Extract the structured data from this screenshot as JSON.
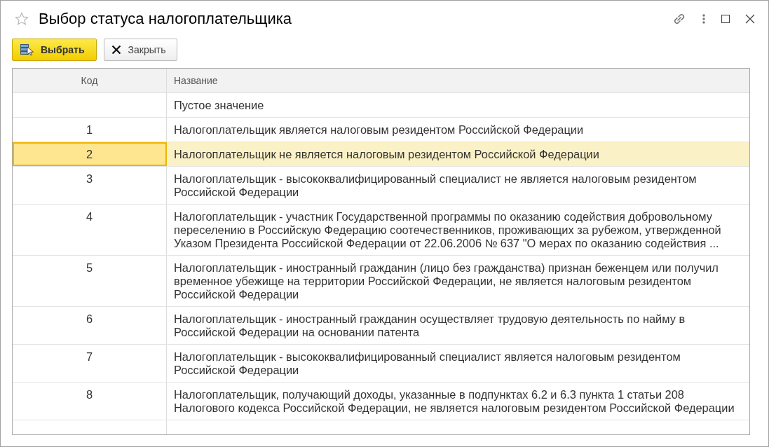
{
  "window": {
    "title": "Выбор статуса налогоплательщика"
  },
  "toolbar": {
    "buttons": [
      {
        "label": "Выбрать",
        "kind": "primary"
      },
      {
        "label": "Закрыть",
        "kind": "close"
      }
    ]
  },
  "table": {
    "columns": [
      "Код",
      "Название"
    ],
    "rows": [
      {
        "code": "",
        "name": "Пустое значение",
        "selected": false
      },
      {
        "code": "1",
        "name": "Налогоплательщик является налоговым резидентом Российской Федерации",
        "selected": false
      },
      {
        "code": "2",
        "name": "Налогоплательщик не является налоговым резидентом Российской Федерации",
        "selected": true
      },
      {
        "code": "3",
        "name": "Налогоплательщик - высококвалифицированный специалист не является налоговым резидентом Российской Федерации",
        "selected": false
      },
      {
        "code": "4",
        "name": "Налогоплательщик - участник Государственной программы по оказанию содействия добровольному переселению в Российскую Федерацию соотечественников, проживающих за рубежом, утвержденной Указом Президента Российской Федерации от 22.06.2006 № 637 \"О мерах по оказанию содействия ...",
        "selected": false
      },
      {
        "code": "5",
        "name": "Налогоплательщик - иностранный гражданин (лицо без гражданства) признан беженцем или получил временное убежище на территории Российской Федерации, не является налоговым резидентом Российской Федерации",
        "selected": false
      },
      {
        "code": "6",
        "name": "Налогоплательщик - иностранный гражданин осуществляет трудовую деятельность по найму в Российской Федерации на основании патента",
        "selected": false
      },
      {
        "code": "7",
        "name": "Налогоплательщик - высококвалифицированный специалист является налоговым резидентом Российской Федерации",
        "selected": false
      },
      {
        "code": "8",
        "name": "Налогоплательщик, получающий доходы, указанные в подпунктах 6.2 и 6.3 пункта 1 статьи 208 Налогового кодекса Российской Федерации, не является налоговым резидентом Российской Федерации",
        "selected": false
      }
    ]
  }
}
